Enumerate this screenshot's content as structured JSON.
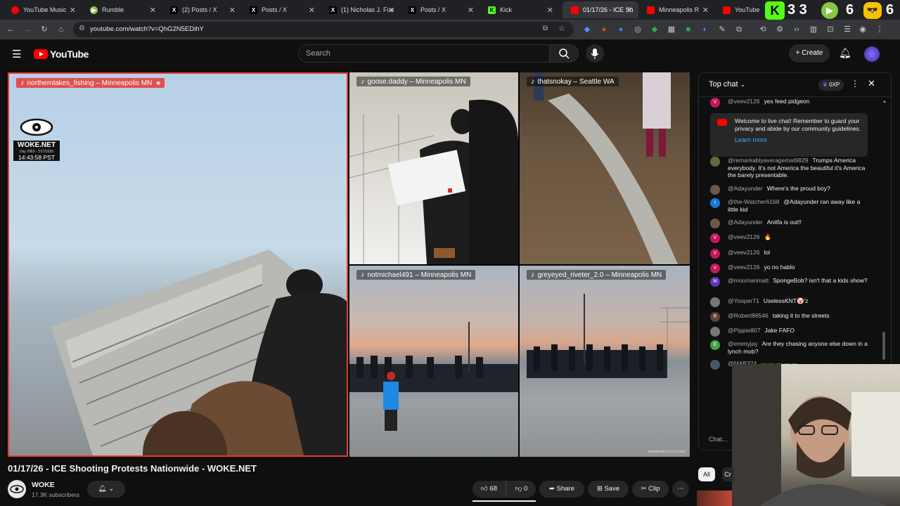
{
  "browser": {
    "tabs": [
      {
        "label": "YouTube Music",
        "favicon_color": "#ff0000"
      },
      {
        "label": "Rumble",
        "favicon_color": "#85c742"
      },
      {
        "label": "(2) Posts / X",
        "favicon_color": "#000000"
      },
      {
        "label": "Posts / X",
        "favicon_color": "#000000"
      },
      {
        "label": "(1) Nicholas J. Fue",
        "favicon_color": "#000000"
      },
      {
        "label": "Posts / X",
        "favicon_color": "#000000"
      },
      {
        "label": "Kick",
        "favicon_color": "#53fc18"
      },
      {
        "label": "01/17/26 - ICE Sh",
        "favicon_color": "#ff0000"
      },
      {
        "label": "Minneapolis R",
        "favicon_color": "#ff0000"
      },
      {
        "label": "YouTube",
        "favicon_color": "#ff0000"
      }
    ],
    "url": "youtube.com/watch?v=QhG2N5EDihY"
  },
  "desktop_overlay": {
    "counter_a": "3 3",
    "counter_b": "6",
    "counter_c": "6"
  },
  "masthead": {
    "logo_text": "YouTube",
    "search_placeholder": "Search",
    "create_label": "Create"
  },
  "video": {
    "watermark_brand": "WOKE.NET",
    "watermark_day": "Day 2063 - 1/17/2026",
    "watermark_time": "14:43:58 PST",
    "footer_credit": "streamwall.io 2.0.0-pre2",
    "tiles": [
      {
        "label": "northernlakes_fishing – Minneapolis MN",
        "highlight": true
      },
      {
        "label": "goose.daddy – Minneapolis MN"
      },
      {
        "label": "thatsnokay – Seattle WA"
      },
      {
        "label": "notmichael491 – Minneapolis MN"
      },
      {
        "label": "greyeyed_riveter_2.0 – Minneapolis MN"
      }
    ]
  },
  "chat": {
    "header_label": "Top chat",
    "points_label": "0XP",
    "welcome_text": "Welcome to live chat! Remember to guard your privacy and abide by our community guidelines.",
    "learn_more": "Learn more",
    "input_placeholder": "Chat...",
    "messages": [
      {
        "author": "@veev2126",
        "text": "yes feed pidgeon",
        "avatar_color": "#c2185b",
        "initial": "V"
      },
      {
        "author": "@remarkablyaveragemat9829",
        "text": "Trumps America everybody. It's not America the beautiful it's America the barely presentable.",
        "avatar_color": "#5c6b3a",
        "initial": ""
      },
      {
        "author": "@Adayunder",
        "text": "Where's the proud boy?",
        "avatar_color": "#6d5a44",
        "initial": ""
      },
      {
        "author": "@the-Watcher6168",
        "text": "@Adayunder ran away like a little kid",
        "avatar_color": "#1976d2",
        "initial": "t"
      },
      {
        "author": "@Adayunder",
        "text": "Anitfa is out!!",
        "avatar_color": "#6d5a44",
        "initial": ""
      },
      {
        "author": "@veev2126",
        "text": "🔥",
        "avatar_color": "#c2185b",
        "initial": "V"
      },
      {
        "author": "@veev2126",
        "text": "lol",
        "avatar_color": "#c2185b",
        "initial": "V"
      },
      {
        "author": "@veev2126",
        "text": "yo no hablo",
        "avatar_color": "#c2185b",
        "initial": "V"
      },
      {
        "author": "@moomanmatt",
        "text": "SpongeBob? isn't that a kids show?",
        "avatar_color": "#5e35b1",
        "initial": "M"
      },
      {
        "author": "@Yooper71",
        "text": "UselessKNT🤡'z",
        "avatar_color": "#777777",
        "initial": ""
      },
      {
        "author": "@Robert86546",
        "text": "taking it to the streets",
        "avatar_color": "#5d4037",
        "initial": "R"
      },
      {
        "author": "@Pippie807",
        "text": "Jake FAFO",
        "avatar_color": "#777777",
        "initial": ""
      },
      {
        "author": "@emmyjay",
        "text": "Are they chasing anyone else down in a lynch mob?",
        "avatar_color": "#43a047",
        "initial": "E"
      },
      {
        "author": "@MAB324",
        "text": "",
        "avatar_color": "#455a64",
        "initial": ""
      }
    ],
    "filter_chips": [
      {
        "label": "All"
      },
      {
        "label": "Cr"
      }
    ]
  },
  "below_video": {
    "title": "01/17/26 - ICE Shooting Protests Nationwide - WOKE.NET",
    "channel_name": "WOKE",
    "subscribers": "17.3K subscribers",
    "like_count": "68",
    "dislike_count": "0",
    "share_label": "Share",
    "save_label": "Save",
    "clip_label": "Clip"
  }
}
